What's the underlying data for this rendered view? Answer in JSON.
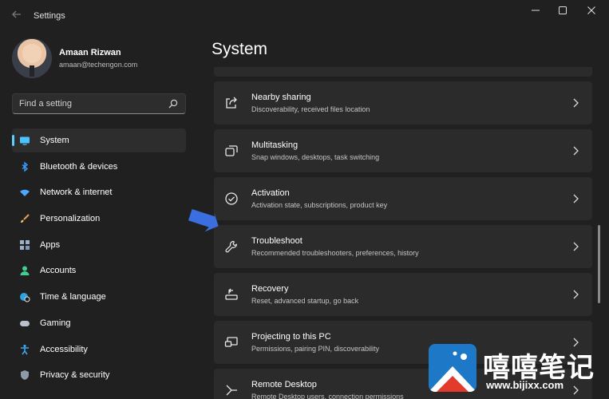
{
  "window": {
    "app_title": "Settings",
    "back_icon": "back-arrow-icon",
    "controls": [
      "minimize-icon",
      "maximize-icon",
      "close-icon"
    ]
  },
  "profile": {
    "name": "Amaan Rizwan",
    "email": "amaan@techengon.com"
  },
  "search": {
    "placeholder": "Find a setting"
  },
  "sidebar": {
    "items": [
      {
        "label": "System",
        "icon": "system-icon",
        "active": true
      },
      {
        "label": "Bluetooth & devices",
        "icon": "bluetooth-icon"
      },
      {
        "label": "Network & internet",
        "icon": "wifi-icon"
      },
      {
        "label": "Personalization",
        "icon": "brush-icon"
      },
      {
        "label": "Apps",
        "icon": "apps-icon"
      },
      {
        "label": "Accounts",
        "icon": "accounts-icon"
      },
      {
        "label": "Time & language",
        "icon": "globe-clock-icon"
      },
      {
        "label": "Gaming",
        "icon": "gamepad-icon"
      },
      {
        "label": "Accessibility",
        "icon": "accessibility-icon"
      },
      {
        "label": "Privacy & security",
        "icon": "shield-icon"
      }
    ]
  },
  "main": {
    "title": "System",
    "cards": [
      {
        "title": "Nearby sharing",
        "subtitle": "Discoverability, received files location",
        "icon": "share-icon"
      },
      {
        "title": "Multitasking",
        "subtitle": "Snap windows, desktops, task switching",
        "icon": "multitasking-icon"
      },
      {
        "title": "Activation",
        "subtitle": "Activation state, subscriptions, product key",
        "icon": "activation-check-icon"
      },
      {
        "title": "Troubleshoot",
        "subtitle": "Recommended troubleshooters, preferences, history",
        "icon": "wrench-icon"
      },
      {
        "title": "Recovery",
        "subtitle": "Reset, advanced startup, go back",
        "icon": "recovery-icon"
      },
      {
        "title": "Projecting to this PC",
        "subtitle": "Permissions, pairing PIN, discoverability",
        "icon": "projecting-icon"
      },
      {
        "title": "Remote Desktop",
        "subtitle": "Remote Desktop users, connection permissions",
        "icon": "remote-desktop-icon"
      }
    ]
  },
  "watermark": {
    "text": "嘻嘻笔记",
    "url": "www.bijixx.com"
  },
  "colors": {
    "background": "#202020",
    "card": "#2b2b2b",
    "accent": "#60cdff",
    "annotation_arrow": "#3b6fe0",
    "watermark_blue": "#1e78c8"
  }
}
